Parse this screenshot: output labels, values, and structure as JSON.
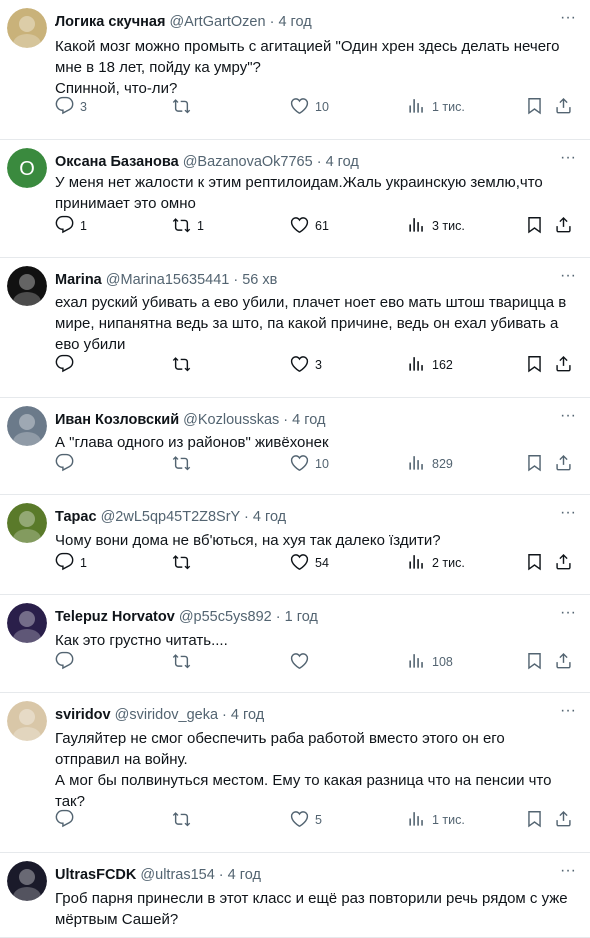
{
  "tweets": [
    {
      "name": "Логика скучная",
      "handle": "@ArtGartOzen",
      "time": "4 год",
      "lines": [
        "Какой мозг можно промыть с агитацией \"Один хрен здесь делать нечего",
        "мне в 18 лет, пойду ка умру\"?",
        "Спинной, что-ли?"
      ],
      "replies": "3",
      "retweets": "",
      "likes": "10",
      "views": "1 тис.",
      "avatar_color": "#c9b27a",
      "avatar_letter": ""
    },
    {
      "name": "Оксана Базанова",
      "handle": "@BazanovaOk7765",
      "time": "4 год",
      "lines": [
        "У меня нет жалости к этим рептилоидам.Жаль украинскую землю,что",
        "принимает это омно"
      ],
      "replies": "1",
      "retweets": "1",
      "likes": "61",
      "views": "3 тис.",
      "avatar_color": "#3a8a3e",
      "avatar_letter": "O"
    },
    {
      "name": "Marina",
      "handle": "@Marina15635441",
      "time": "56 хв",
      "lines": [
        "ехал руский убивать а ево убили, плачет ноет ево мать штош тварицца в",
        "мире, нипанятна ведь за што, па какой причине, ведь он ехал убивать а",
        "ево убили"
      ],
      "replies": "",
      "retweets": "",
      "likes": "3",
      "views": "162",
      "avatar_color": "#111111",
      "avatar_letter": ""
    },
    {
      "name": "Иван Козловский",
      "handle": "@Kozlousskas",
      "time": "4 год",
      "lines": [
        "А \"глава одного из районов\" живёхонек"
      ],
      "replies": "",
      "retweets": "",
      "likes": "10",
      "views": "829",
      "avatar_color": "#6b7a8a",
      "avatar_letter": ""
    },
    {
      "name": "Тарас",
      "handle": "@2wL5qp45T2Z8SrY",
      "time": "4 год",
      "lines": [
        "Чому вони дома не вб'ються, на хуя так далеко їздити?"
      ],
      "replies": "1",
      "retweets": "",
      "likes": "54",
      "views": "2 тис.",
      "avatar_color": "#5a7a2a",
      "avatar_letter": ""
    },
    {
      "name": "Telepuz Horvatov",
      "handle": "@p55c5ys892",
      "time": "1 год",
      "lines": [
        "Как это грустно читать...."
      ],
      "replies": "",
      "retweets": "",
      "likes": "",
      "views": "108",
      "avatar_color": "#2a1f4a",
      "avatar_letter": ""
    },
    {
      "name": "sviridov",
      "handle": "@sviridov_geka",
      "time": "4 год",
      "lines": [
        "Гауляйтер не смог обеспечить  раба работой вместо этого он его",
        "отправил на войну.",
        "А мог бы полвинуться местом. Ему то какая разница что на пенсии что",
        "так?"
      ],
      "replies": "",
      "retweets": "",
      "likes": "5",
      "views": "1 тис.",
      "avatar_color": "#d9c7a8",
      "avatar_letter": ""
    },
    {
      "name": "UltrasFCDK",
      "handle": "@ultras154",
      "time": "4 год",
      "lines": [
        "Гроб парня принесли в этот класс и ещё раз повторили речь рядом с уже",
        "мёртвым Сашей?"
      ],
      "replies": "",
      "retweets": "",
      "likes": "",
      "views": "",
      "avatar_color": "#1a1a2a",
      "avatar_letter": ""
    }
  ],
  "icons": {
    "more": "more-icon",
    "reply": "reply-icon",
    "retweet": "retweet-icon",
    "like": "like-icon",
    "views": "views-icon",
    "bookmark": "bookmark-icon",
    "share": "share-icon"
  },
  "colors": {
    "text": "#0f1419",
    "muted": "#536471",
    "divider": "#e6e9ec"
  }
}
